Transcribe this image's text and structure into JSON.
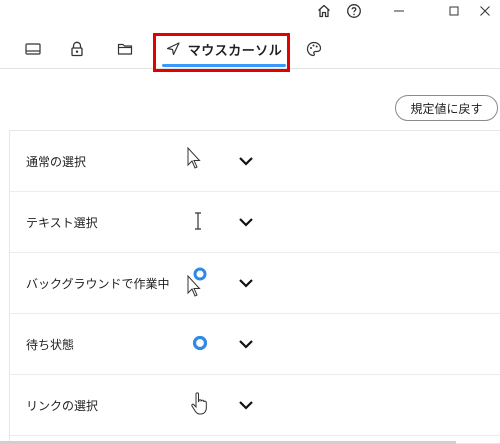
{
  "window": {
    "home_icon": "home-icon",
    "help_icon": "help-icon",
    "minimize_icon": "minimize-icon",
    "maximize_icon": "maximize-icon",
    "close_icon": "close-icon"
  },
  "tabs": [
    {
      "id": "display",
      "icon": "display-icon",
      "label": ""
    },
    {
      "id": "lock",
      "icon": "lock-icon",
      "label": ""
    },
    {
      "id": "folder",
      "icon": "folder-icon",
      "label": ""
    },
    {
      "id": "mouse-cursor",
      "icon": "cursor-arrow-icon",
      "label": "マウスカーソル",
      "active": true
    },
    {
      "id": "palette",
      "icon": "palette-icon",
      "label": ""
    }
  ],
  "accent_color": "#3b99fc",
  "highlight_color": "#e30000",
  "reset_button": {
    "label": "規定値に戻す"
  },
  "rows": [
    {
      "label": "通常の選択",
      "cursor_icon": "arrow-pointer-icon"
    },
    {
      "label": "テキスト選択",
      "cursor_icon": "text-beam-icon"
    },
    {
      "label": "バックグラウンドで作業中",
      "cursor_icon": "arrow-busy-icon"
    },
    {
      "label": "待ち状態",
      "cursor_icon": "busy-ring-icon"
    },
    {
      "label": "リンクの選択",
      "cursor_icon": "hand-pointer-icon"
    }
  ]
}
